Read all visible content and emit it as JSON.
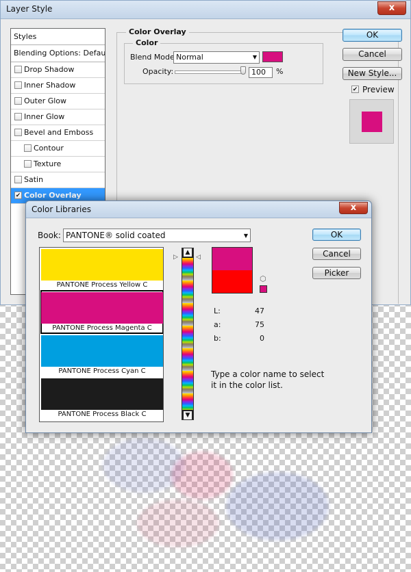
{
  "layer_style": {
    "title": "Layer Style",
    "close_label": "x",
    "list_header": "Styles",
    "blending_options": "Blending Options: Default",
    "items": [
      {
        "label": "Drop Shadow",
        "checked": false,
        "sub": false
      },
      {
        "label": "Inner Shadow",
        "checked": false,
        "sub": false
      },
      {
        "label": "Outer Glow",
        "checked": false,
        "sub": false
      },
      {
        "label": "Inner Glow",
        "checked": false,
        "sub": false
      },
      {
        "label": "Bevel and Emboss",
        "checked": false,
        "sub": false
      },
      {
        "label": "Contour",
        "checked": false,
        "sub": true
      },
      {
        "label": "Texture",
        "checked": false,
        "sub": true
      },
      {
        "label": "Satin",
        "checked": false,
        "sub": false
      },
      {
        "label": "Color Overlay",
        "checked": true,
        "sub": false,
        "selected": true
      }
    ],
    "panel_title": "Color Overlay",
    "group_title": "Color",
    "blend_mode_label": "Blend Mode:",
    "blend_mode_value": "Normal",
    "overlay_color": "#d70f7f",
    "opacity_label": "Opacity:",
    "opacity_value": "100",
    "opacity_unit": "%",
    "opacity_level": 1.0,
    "buttons": {
      "ok": "OK",
      "cancel": "Cancel",
      "new_style": "New Style..."
    },
    "preview_label": "Preview",
    "preview_checked": true
  },
  "color_libraries": {
    "title": "Color Libraries",
    "close_label": "x",
    "book_label": "Book:",
    "book_value": "PANTONE® solid coated",
    "swatches": [
      {
        "name": "PANTONE Process Yellow C",
        "color": "#ffe100"
      },
      {
        "name": "PANTONE Process Magenta C",
        "color": "#d70f7f",
        "selected": true
      },
      {
        "name": "PANTONE Process Cyan C",
        "color": "#009fe0"
      },
      {
        "name": "PANTONE Process Black C",
        "color": "#1c1c1c"
      }
    ],
    "new_color": "#d70f7f",
    "old_color": "#ff0000",
    "lab": [
      {
        "key": "L:",
        "value": "47"
      },
      {
        "key": "a:",
        "value": "75"
      },
      {
        "key": "b:",
        "value": "0"
      }
    ],
    "hint": "Type a color name to select it in the color list.",
    "buttons": {
      "ok": "OK",
      "cancel": "Cancel",
      "picker": "Picker"
    }
  }
}
